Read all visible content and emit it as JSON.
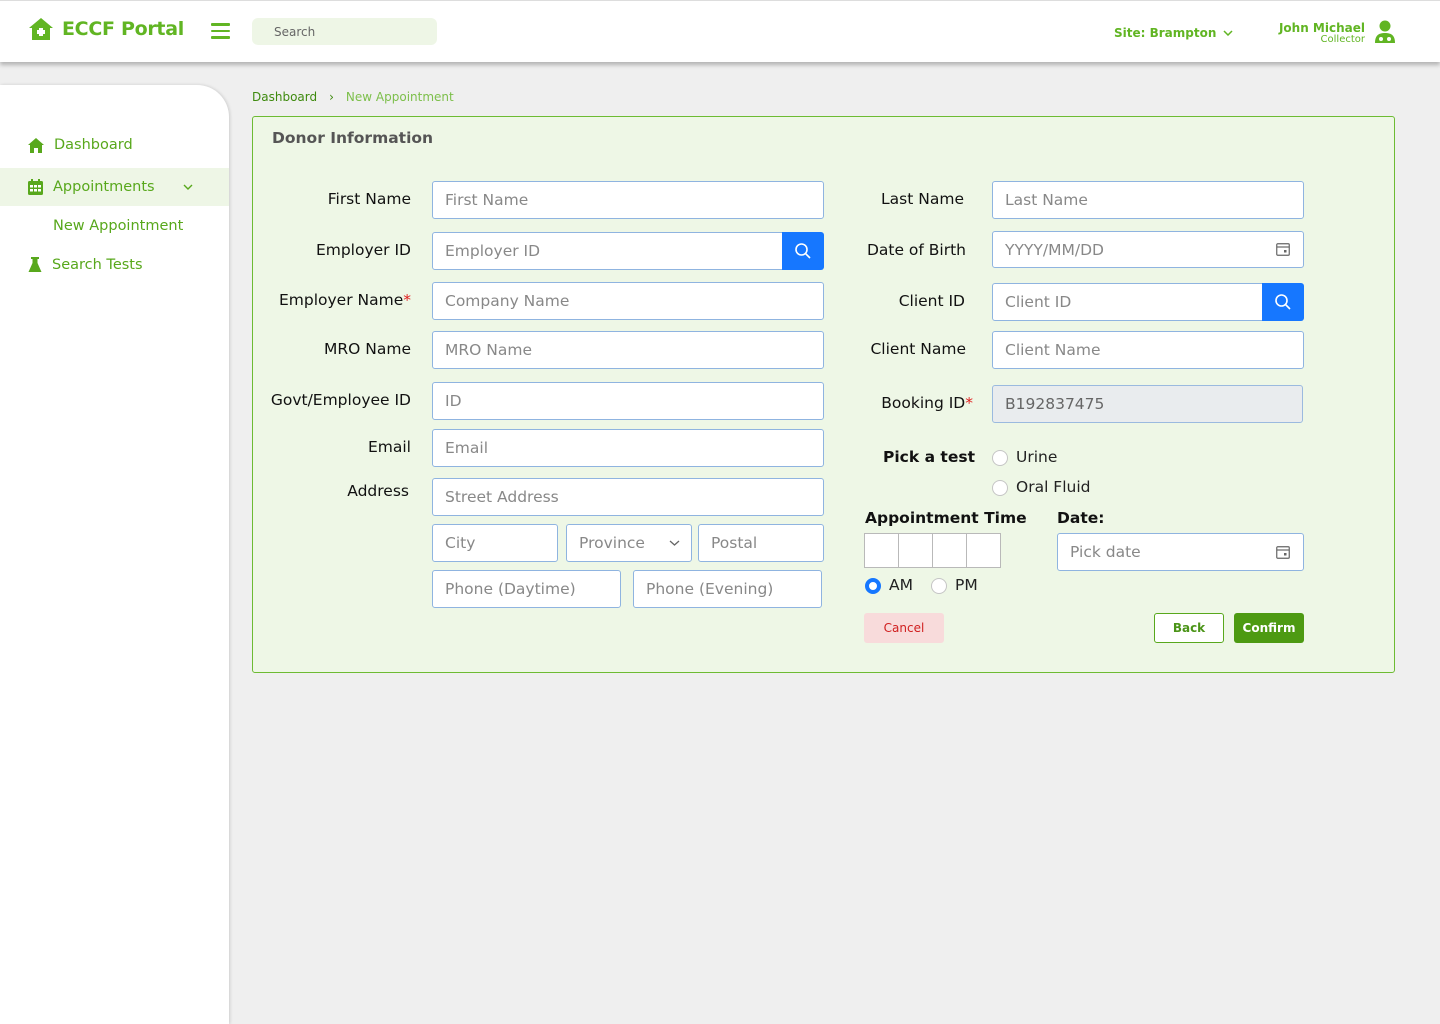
{
  "app": {
    "title": "ECCF Portal"
  },
  "header": {
    "search_placeholder": "Search",
    "site_label": "Site: Brampton",
    "user_name": "John Michael",
    "user_role": "Collector"
  },
  "sidebar": {
    "items": [
      {
        "label": "Dashboard",
        "icon": "home-icon"
      },
      {
        "label": "Appointments",
        "icon": "calendar-icon"
      },
      {
        "label": "Search Tests",
        "icon": "flask-icon"
      }
    ],
    "sub_items": [
      "New Appointment"
    ]
  },
  "breadcrumb": {
    "root": "Dashboard",
    "separator": "›",
    "current": "New Appointment"
  },
  "form": {
    "title": "Donor Information",
    "first_name": {
      "label": "First Name",
      "placeholder": "First Name"
    },
    "employer_id": {
      "label": "Employer ID",
      "placeholder": "Employer ID"
    },
    "employer_name": {
      "label": "Employer Name",
      "required": "*",
      "placeholder": "Company Name"
    },
    "mro_name": {
      "label": "MRO Name",
      "placeholder": "MRO Name"
    },
    "govt_id": {
      "label": "Govt/Employee ID",
      "placeholder": "ID"
    },
    "email": {
      "label": "Email",
      "placeholder": "Email"
    },
    "address": {
      "label": "Address",
      "street_placeholder": "Street Address",
      "city_placeholder": "City",
      "province_value": "Province",
      "postal_placeholder": "Postal",
      "phone_day_placeholder": "Phone (Daytime)",
      "phone_eve_placeholder": "Phone (Evening)"
    },
    "last_name": {
      "label": "Last Name",
      "placeholder": "Last Name"
    },
    "dob": {
      "label": "Date of Birth",
      "placeholder": "YYYY/MM/DD"
    },
    "client_id": {
      "label": "Client ID",
      "placeholder": "Client ID"
    },
    "client_name": {
      "label": "Client Name",
      "placeholder": "Client Name"
    },
    "booking_id": {
      "label": "Booking ID",
      "required": "*",
      "value": "B192837475"
    },
    "test": {
      "label": "Pick a test",
      "options": [
        "Urine",
        "Oral Fluid"
      ]
    },
    "appointment_time": {
      "label": "Appointment Time",
      "am": "AM",
      "pm": "PM",
      "selected": "AM"
    },
    "date": {
      "label": "Date:",
      "placeholder": "Pick date"
    },
    "buttons": {
      "cancel": "Cancel",
      "back": "Back",
      "confirm": "Confirm"
    }
  },
  "colors": {
    "brand_green": "#61b523",
    "panel_bg": "#eef7e6",
    "accent_blue": "#1677ff",
    "danger": "#d02020"
  }
}
